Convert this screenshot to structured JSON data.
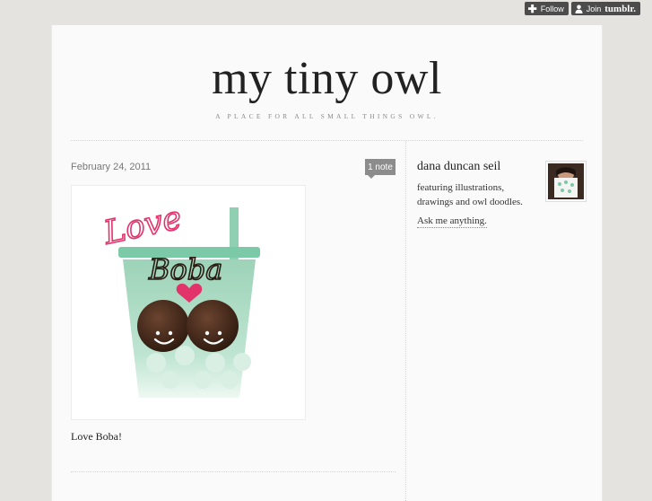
{
  "tumblr_controls": {
    "follow_label": "Follow",
    "join_label": "Join",
    "brand": "tumblr."
  },
  "blog": {
    "title": "my tiny owl",
    "subtitle": "A PLACE FOR ALL SMALL THINGS OWL."
  },
  "post": {
    "date": "February 24, 2011",
    "notes": "1 note",
    "caption": "Love Boba!",
    "image": {
      "line1": "Love",
      "line2": "Boba",
      "colors": {
        "cup": "#9dd3b8",
        "lid": "#7cc9a8",
        "pearl": "#4a2e1c",
        "heart": "#e2336b",
        "love_text": "#e2336b"
      }
    }
  },
  "sidebar": {
    "author": "dana duncan seil",
    "description": "featuring illustrations, drawings and owl doodles.",
    "ask_link": "Ask me anything."
  },
  "colors": {
    "background": "#e5e3df",
    "page": "#fafafa",
    "badge": "#8c8c8c",
    "toolbar": "#4c4c4c"
  }
}
